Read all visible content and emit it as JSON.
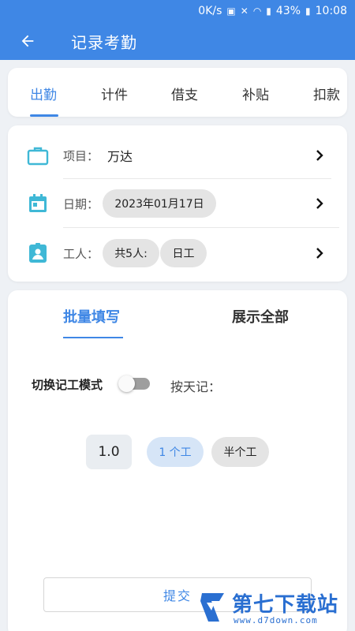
{
  "status_bar": {
    "net_speed": "0K/s",
    "battery": "43%",
    "time": "10:08"
  },
  "app_bar": {
    "title": "记录考勤"
  },
  "tabs": [
    {
      "label": "出勤",
      "active": true
    },
    {
      "label": "计件",
      "active": false
    },
    {
      "label": "借支",
      "active": false
    },
    {
      "label": "补贴",
      "active": false
    },
    {
      "label": "扣款",
      "active": false
    }
  ],
  "info": {
    "project_label": "项目：",
    "project_value": "万达",
    "date_label": "日期：",
    "date_value": "2023年01月17日",
    "worker_label": "工人：",
    "worker_count": "共5人:",
    "worker_type": "日工"
  },
  "sub_tabs": {
    "batch": "批量填写",
    "show_all": "展示全部"
  },
  "mode": {
    "switch_label": "切换记工模式",
    "switch_on": false,
    "by_day_label": "按天记："
  },
  "workload": {
    "value": "1.0",
    "option_full": "1 个工",
    "option_half": "半个工",
    "selected": "1 个工"
  },
  "submit_label": "提交",
  "watermark": {
    "brand": "第七下载站",
    "url": "www.d7down.com"
  },
  "colors": {
    "accent": "#3f87e5",
    "icon_teal": "#3fb8d6"
  }
}
